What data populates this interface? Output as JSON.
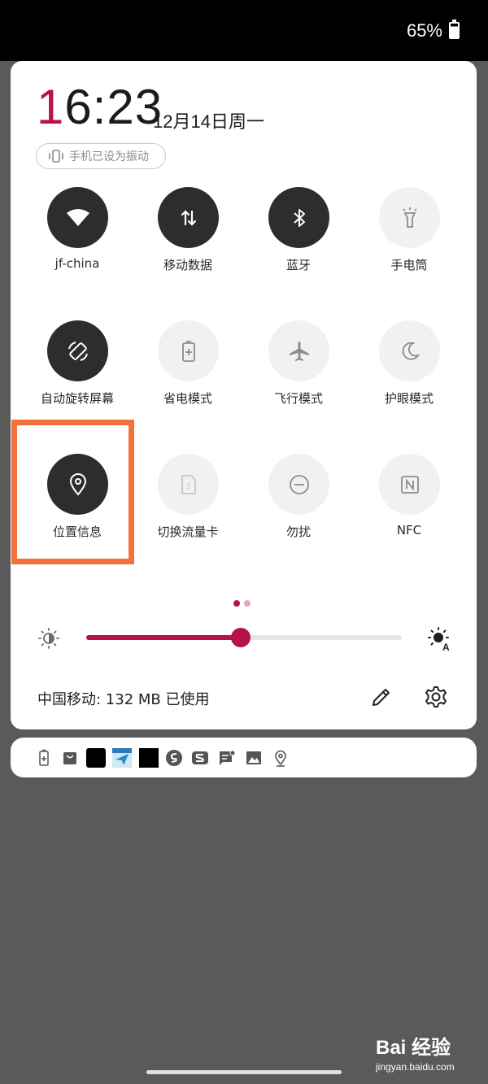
{
  "status_bar": {
    "battery_percent": "65%"
  },
  "header": {
    "time_first": "1",
    "time_rest": "6:23",
    "date": "12月14日周一",
    "vibrate_chip": "手机已设为振动"
  },
  "tiles": [
    {
      "label": "jf-china",
      "icon": "wifi-icon",
      "state": "on"
    },
    {
      "label": "移动数据",
      "icon": "mobile-data-icon",
      "state": "on"
    },
    {
      "label": "蓝牙",
      "icon": "bluetooth-icon",
      "state": "on"
    },
    {
      "label": "手电筒",
      "icon": "flashlight-icon",
      "state": "off"
    },
    {
      "label": "自动旋转屏幕",
      "icon": "auto-rotate-icon",
      "state": "on"
    },
    {
      "label": "省电模式",
      "icon": "battery-saver-icon",
      "state": "off"
    },
    {
      "label": "飞行模式",
      "icon": "airplane-icon",
      "state": "off"
    },
    {
      "label": "护眼模式",
      "icon": "moon-icon",
      "state": "off"
    },
    {
      "label": "位置信息",
      "icon": "location-icon",
      "state": "on"
    },
    {
      "label": "切换流量卡",
      "icon": "sim-card-icon",
      "state": "off"
    },
    {
      "label": "勿扰",
      "icon": "do-not-disturb-icon",
      "state": "off"
    },
    {
      "label": "NFC",
      "icon": "nfc-icon",
      "state": "off"
    }
  ],
  "page_indicator": {
    "pages": 2,
    "current": 1
  },
  "brightness": {
    "level": 0.49
  },
  "footer": {
    "carrier_usage": "中国移动: 132 MB 已使用"
  },
  "notification_icons": [
    "battery-icon",
    "bag-icon",
    "black-square-icon",
    "ticket-app-icon",
    "black-square-icon",
    "s-app-icon",
    "s-logo-icon",
    "message-icon",
    "image-icon",
    "location-icon"
  ],
  "watermark": {
    "brand": "Bai 经验",
    "url": "jingyan.baidu.com"
  },
  "colors": {
    "accent": "#b5124a",
    "highlight": "#f4713b",
    "tile_on": "#2d2d2d",
    "tile_off": "#f1f1f1"
  }
}
